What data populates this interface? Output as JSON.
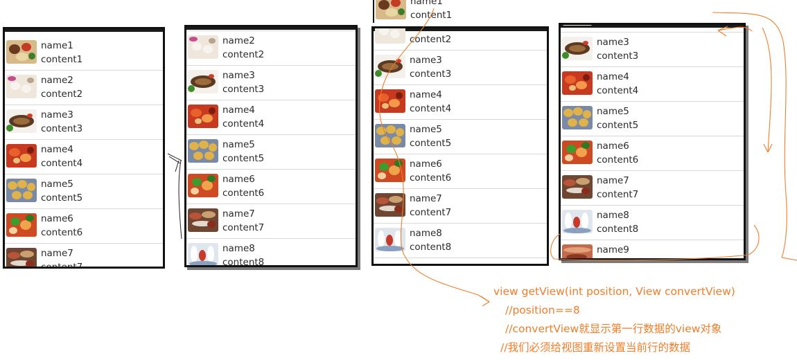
{
  "colors": {
    "annotation": "#f07d2a",
    "frame": "#111111",
    "pencil": "#222222"
  },
  "rows": [
    {
      "name": "name1",
      "content": "content1",
      "thumb": "platter"
    },
    {
      "name": "name2",
      "content": "content2",
      "thumb": "dumplings"
    },
    {
      "name": "name3",
      "content": "content3",
      "thumb": "fish"
    },
    {
      "name": "name4",
      "content": "content4",
      "thumb": "red-dish"
    },
    {
      "name": "name5",
      "content": "content5",
      "thumb": "tarts"
    },
    {
      "name": "name6",
      "content": "content6",
      "thumb": "salad"
    },
    {
      "name": "name7",
      "content": "content7",
      "thumb": "skewers"
    },
    {
      "name": "name8",
      "content": "content8",
      "thumb": "glasses"
    },
    {
      "name": "name9",
      "content": "",
      "thumb": "grill"
    }
  ],
  "panels": [
    {
      "id": "panel-1",
      "first_row": 1
    },
    {
      "id": "panel-2",
      "first_row": 1
    },
    {
      "id": "panel-3",
      "first_row": 1,
      "detached_first_row": true
    },
    {
      "id": "panel-4",
      "first_row": 2
    }
  ],
  "annotation": {
    "lines": [
      "view getView(int position, View convertView)",
      "  //position==8",
      "  //convertView就显示第一行数据的view对象",
      "//我们必须给视图重新设置当前行的数据"
    ]
  }
}
